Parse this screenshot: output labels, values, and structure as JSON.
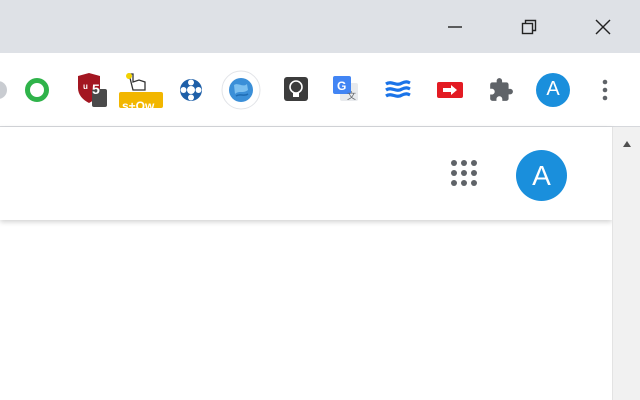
{
  "window_controls": {
    "minimize_icon": "minimize-icon",
    "restore_icon": "restore-icon",
    "close_icon": "close-icon"
  },
  "toolbar": {
    "extensions": [
      {
        "name": "green-ring-extension",
        "icon": "green-ring-icon"
      },
      {
        "name": "ublock-extension",
        "icon": "shield-icon",
        "badge": "5"
      },
      {
        "name": "pointer-badge-extension",
        "icon": "hand-pointer-icon",
        "badge": "s+Ow"
      },
      {
        "name": "lifebuoy-extension",
        "icon": "lifebuoy-icon"
      },
      {
        "name": "globe-extension",
        "icon": "globe-icon"
      },
      {
        "name": "lightbulb-extension",
        "icon": "lightbulb-icon"
      },
      {
        "name": "translate-extension",
        "icon": "translate-icon"
      },
      {
        "name": "waves-extension",
        "icon": "waves-icon"
      },
      {
        "name": "red-arrow-extension",
        "icon": "red-arrow-icon"
      },
      {
        "name": "extensions-menu",
        "icon": "puzzle-icon"
      }
    ],
    "profile_initial": "A",
    "menu_icon": "kebab-menu-icon"
  },
  "page": {
    "apps_icon": "apps-grid-icon",
    "account_initial": "A"
  },
  "colors": {
    "titlebar": "#dee1e6",
    "avatar": "#1a8fdc",
    "ublock_red": "#a31621",
    "badge_yellow": "#f2b600",
    "translate_blue": "#4285f4",
    "red_ext": "#e31b23"
  }
}
